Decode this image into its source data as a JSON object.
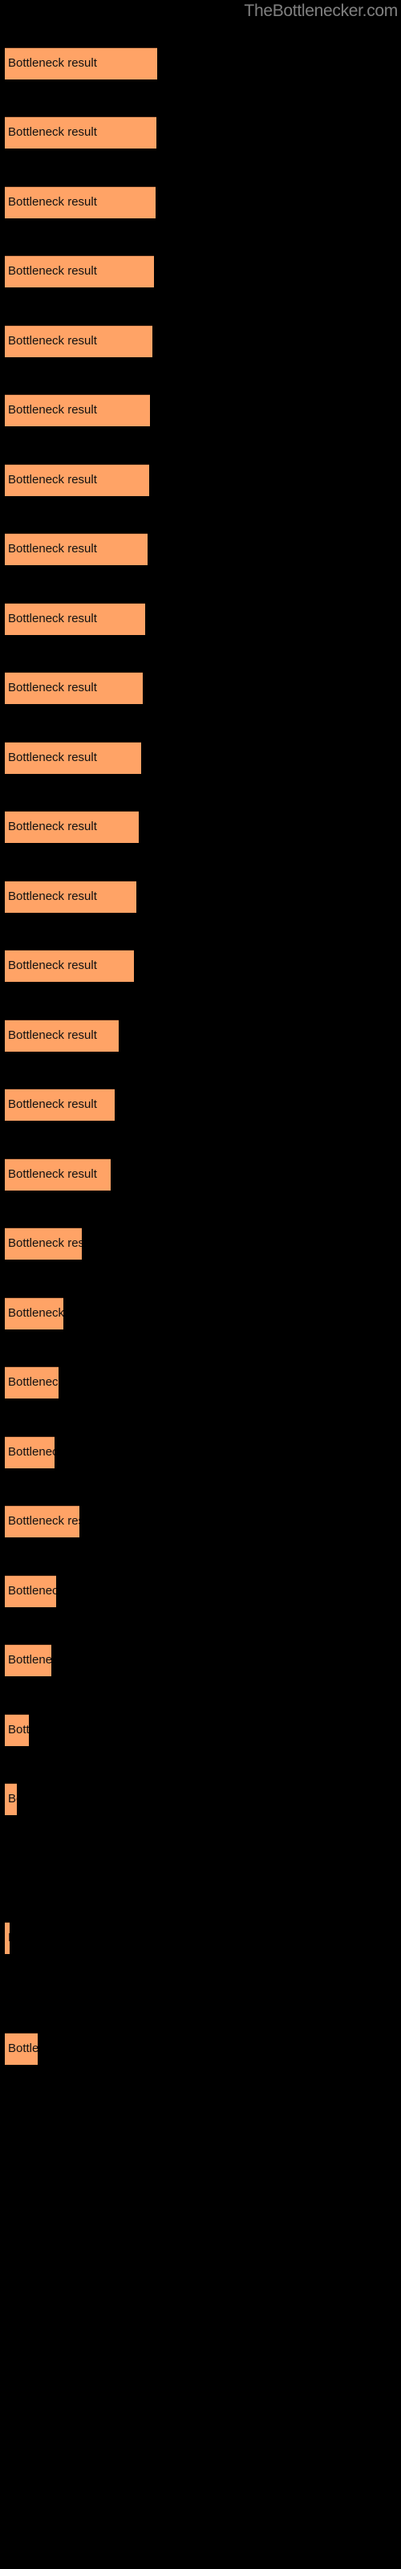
{
  "watermark": "TheBottlenecker.com",
  "colors": {
    "background": "#000000",
    "bar_fill": "#FFA366",
    "bar_border": "#3A2010",
    "label_text": "#111111",
    "watermark_text": "#808080"
  },
  "chart_data": {
    "type": "bar",
    "orientation": "horizontal",
    "title": "",
    "subtitle": "",
    "xlabel": "",
    "ylabel": "",
    "grid": false,
    "legend": false,
    "axis_visible": false,
    "categories": [
      "Bottleneck result",
      "Bottleneck result",
      "Bottleneck result",
      "Bottleneck result",
      "Bottleneck result",
      "Bottleneck result",
      "Bottleneck result",
      "Bottleneck result",
      "Bottleneck result",
      "Bottleneck result",
      "Bottleneck result",
      "Bottleneck result",
      "Bottleneck result",
      "Bottleneck result",
      "Bottleneck result",
      "Bottleneck result",
      "Bottleneck result",
      "Bottleneck result",
      "Bottleneck result",
      "Bottleneck result",
      "Bottleneck result",
      "Bottleneck result",
      "Bottleneck result",
      "Bottleneck result",
      "Bottleneck result",
      "Bottleneck result",
      "Bottleneck result",
      "Bottleneck result"
    ],
    "values": [
      190,
      189,
      188,
      186,
      184,
      181,
      180,
      178,
      175,
      172,
      170,
      167,
      164,
      161,
      142,
      137,
      132,
      96,
      73,
      67,
      62,
      93,
      64,
      58,
      30,
      15,
      6,
      41
    ],
    "xlim": [
      0,
      500
    ],
    "bar_label_text": "Bottleneck result"
  },
  "bars": [
    {
      "label": "Bottleneck result",
      "top": 59,
      "width": 190
    },
    {
      "label": "Bottleneck result",
      "top": 145,
      "width": 189
    },
    {
      "label": "Bottleneck result",
      "top": 232,
      "width": 188
    },
    {
      "label": "Bottleneck result",
      "top": 318,
      "width": 186
    },
    {
      "label": "Bottleneck result",
      "top": 405,
      "width": 184
    },
    {
      "label": "Bottleneck result",
      "top": 491,
      "width": 181
    },
    {
      "label": "Bottleneck result",
      "top": 578,
      "width": 180
    },
    {
      "label": "Bottleneck result",
      "top": 664,
      "width": 178
    },
    {
      "label": "Bottleneck result",
      "top": 751,
      "width": 175
    },
    {
      "label": "Bottleneck result",
      "top": 837,
      "width": 172
    },
    {
      "label": "Bottleneck result",
      "top": 924,
      "width": 170
    },
    {
      "label": "Bottleneck result",
      "top": 1010,
      "width": 167
    },
    {
      "label": "Bottleneck result",
      "top": 1097,
      "width": 164
    },
    {
      "label": "Bottleneck result",
      "top": 1183,
      "width": 161
    },
    {
      "label": "Bottleneck result",
      "top": 1270,
      "width": 142
    },
    {
      "label": "Bottleneck result",
      "top": 1356,
      "width": 137
    },
    {
      "label": "Bottleneck result",
      "top": 1443,
      "width": 132
    },
    {
      "label": "Bottleneck result",
      "top": 1529,
      "width": 96
    },
    {
      "label": "Bottleneck result",
      "top": 1616,
      "width": 73
    },
    {
      "label": "Bottleneck result",
      "top": 1702,
      "width": 67
    },
    {
      "label": "Bottleneck result",
      "top": 1789,
      "width": 62
    },
    {
      "label": "Bottleneck result",
      "top": 1875,
      "width": 93
    },
    {
      "label": "Bottleneck result",
      "top": 1962,
      "width": 64
    },
    {
      "label": "Bottleneck result",
      "top": 2048,
      "width": 58
    },
    {
      "label": "Bottleneck result",
      "top": 2135,
      "width": 30
    },
    {
      "label": "Bottleneck result",
      "top": 2221,
      "width": 15
    },
    {
      "label": "Bottleneck result",
      "top": 2394,
      "width": 6
    },
    {
      "label": "Bottleneck result",
      "top": 2532,
      "width": 41
    }
  ]
}
